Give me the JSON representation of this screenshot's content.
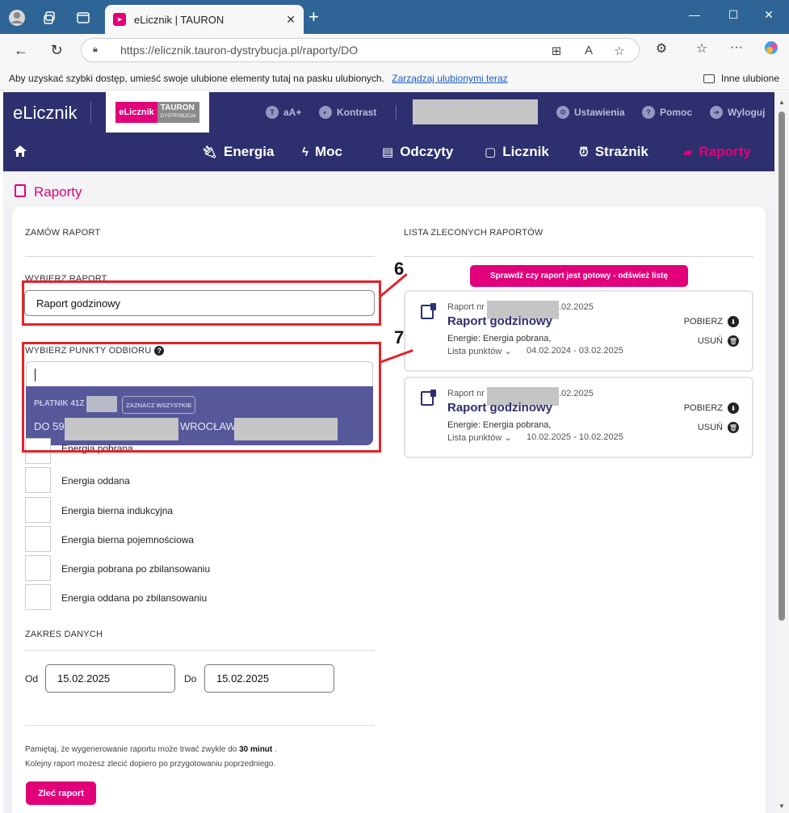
{
  "browser": {
    "tab_title": "eLicznik | TAURON",
    "url": "https://elicznik.tauron-dystrybucja.pl/raporty/DO",
    "favorites_text": "Aby uzyskać szybki dostęp, umieść swoje ulubione elementy tutaj na pasku ulubionych.",
    "favorites_link": "Zarządzaj ulubionymi teraz",
    "other_favorites": "Inne ulubione"
  },
  "header": {
    "brand": "eLicznik",
    "logo_left": "eLicznik",
    "logo_right": "TAURON",
    "logo_sub": "DYSTRYBUCJA",
    "font_size": "aA+",
    "contrast": "Kontrast",
    "settings": "Ustawienia",
    "help": "Pomoc",
    "logout": "Wyloguj"
  },
  "nav": {
    "items": [
      "Energia",
      "Moc",
      "Odczyty",
      "Licznik",
      "Strażnik",
      "Raporty"
    ],
    "active": "Raporty"
  },
  "page": {
    "title": "Raporty"
  },
  "order": {
    "section": "ZAMÓW RAPORT",
    "choose_report_label": "WYBIERZ RAPORT",
    "report_value": "Raport godzinowy",
    "choose_points_label": "WYBIERZ PUNKTY ODBIORU",
    "payer": "PŁATNIK 41Z",
    "select_all": "ZAZNACZ WSZYSTKIE",
    "point_prefix": "DO 59",
    "point_city": "WROCŁAW",
    "checkboxes": [
      "Energia pobrana",
      "Energia oddana",
      "Energia bierna indukcyjna",
      "Energia bierna pojemnościowa",
      "Energia pobrana po zbilansowaniu",
      "Energia oddana po zbilansowaniu"
    ],
    "range_label": "ZAKRES DANYCH",
    "from_label": "Od",
    "from_value": "15.02.2025",
    "to_label": "Do",
    "to_value": "15.02.2025",
    "note1_a": "Pamiętaj, że wygenerowanie raportu może trwać zwykle do ",
    "note1_b": "30 minut",
    "note1_c": " .",
    "note2": "Kolejny raport możesz zlecić dopiero po przygotowaniu poprzedniego.",
    "submit": "Zleć raport"
  },
  "reports": {
    "section": "LISTA ZLECONYCH RAPORTÓW",
    "refresh": "Sprawdź czy raport jest gotowy - odśwież listę",
    "items": [
      {
        "nr_prefix": "Raport nr",
        "nr_suffix": ".02.2025",
        "title": "Raport godzinowy",
        "energy": "Energie: Energia pobrana,",
        "points": "Lista punktów",
        "range": "04.02.2024 - 03.02.2025",
        "download": "POBIERZ",
        "delete": "USUŃ"
      },
      {
        "nr_prefix": "Raport nr",
        "nr_suffix": ".02.2025",
        "title": "Raport godzinowy",
        "energy": "Energie: Energia pobrana,",
        "points": "Lista punktów",
        "range": "10.02.2025 - 10.02.2025",
        "download": "POBIERZ",
        "delete": "USUŃ"
      }
    ]
  },
  "annotations": {
    "first": "6",
    "second": "7"
  },
  "colors": {
    "accent": "#e2007a",
    "navy": "#2d2f6e",
    "annotation": "#e3242b"
  }
}
